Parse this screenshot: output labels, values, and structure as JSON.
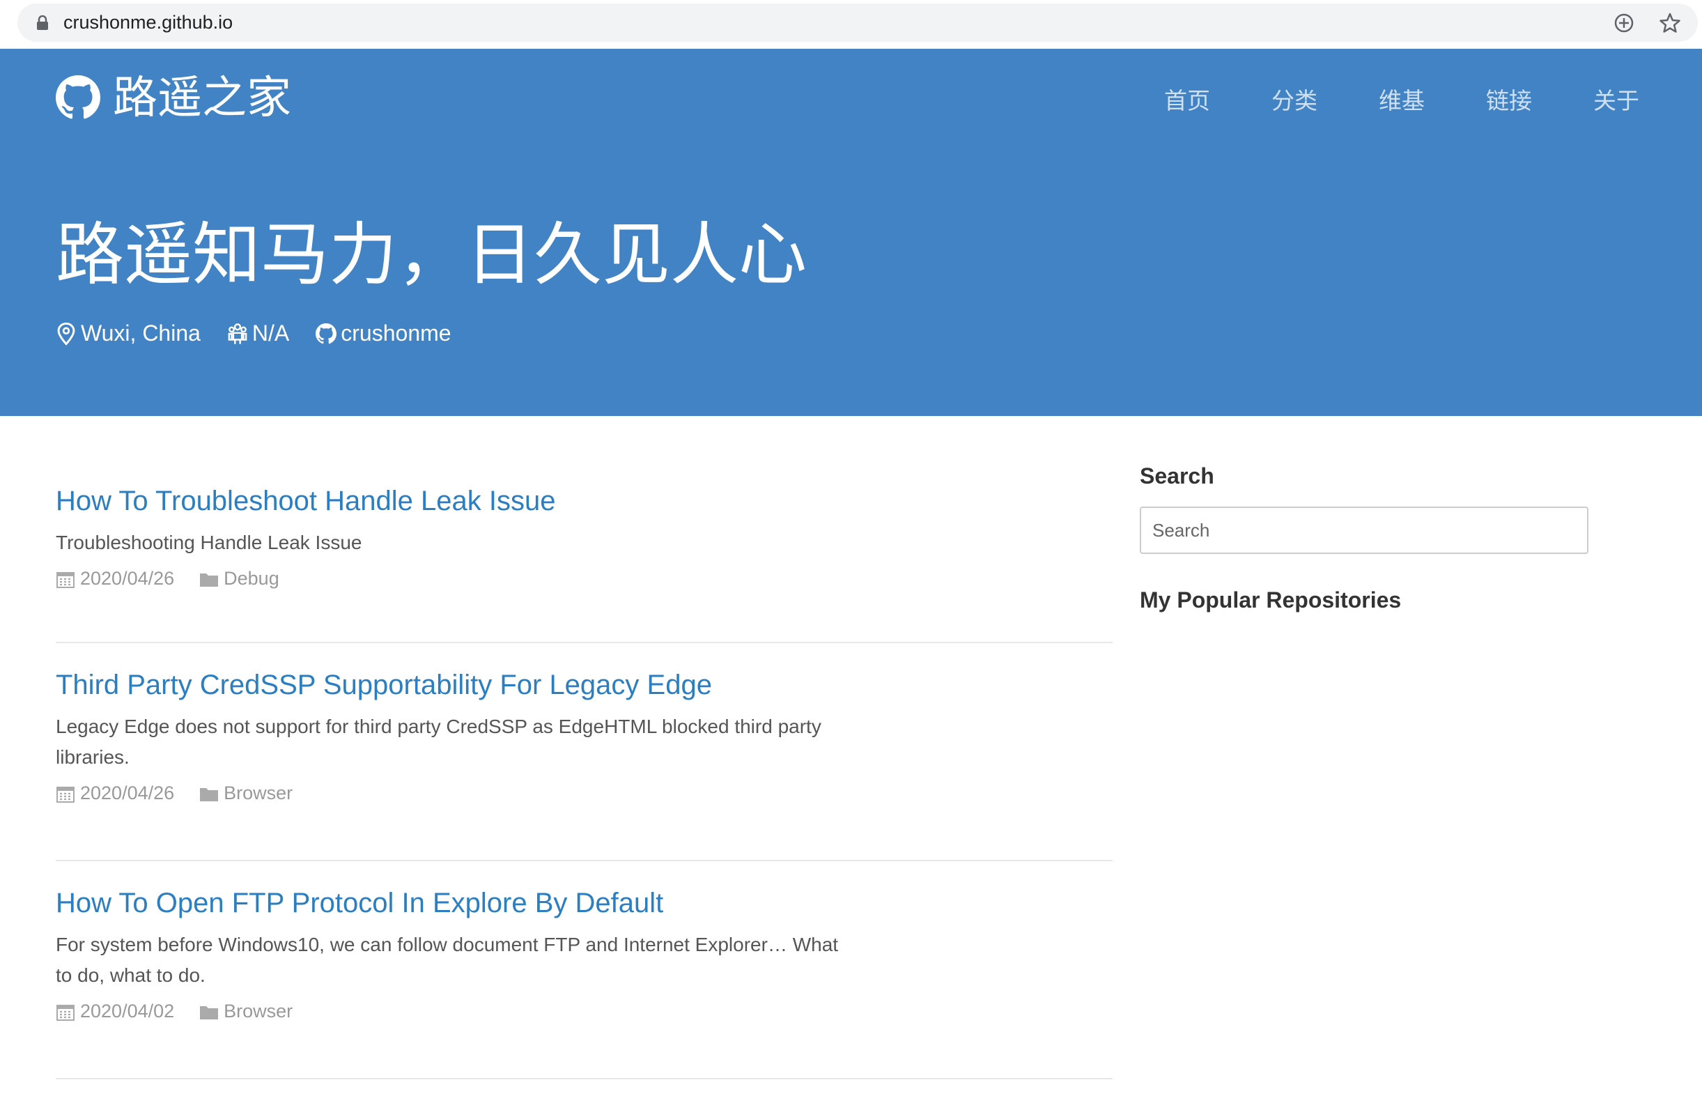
{
  "browser": {
    "url": "crushonme.github.io",
    "icons": [
      "lock-icon",
      "install-app-icon",
      "bookmark-star-icon"
    ]
  },
  "header": {
    "brand": "路遥之家",
    "brand_icon": "github-icon",
    "nav": [
      {
        "label": "首页"
      },
      {
        "label": "分类"
      },
      {
        "label": "维基"
      },
      {
        "label": "链接"
      },
      {
        "label": "关于"
      }
    ],
    "hero_title": "路遥知马力，日久见人心",
    "meta": {
      "location": "Wuxi, China",
      "organization": "N/A",
      "github": "crushonme"
    },
    "colors": {
      "banner": "#4183c4"
    }
  },
  "posts": [
    {
      "title": "How To Troubleshoot Handle Leak Issue",
      "description": "Troubleshooting Handle Leak Issue",
      "date": "2020/04/26",
      "category": "Debug"
    },
    {
      "title": "Third Party CredSSP Supportability For Legacy Edge",
      "description": "Legacy Edge does not support for third party CredSSP as EdgeHTML blocked third party libraries.",
      "date": "2020/04/26",
      "category": "Browser"
    },
    {
      "title": "How To Open FTP Protocol In Explore By Default",
      "description": "For system before Windows10, we can follow document FTP and Internet Explorer… What to do, what to do.",
      "date": "2020/04/02",
      "category": "Browser"
    }
  ],
  "sidebar": {
    "search_heading": "Search",
    "search_placeholder": "Search",
    "repos_heading": "My Popular Repositories"
  },
  "colors": {
    "link": "#2a7ec1",
    "meta_text": "#999999"
  }
}
